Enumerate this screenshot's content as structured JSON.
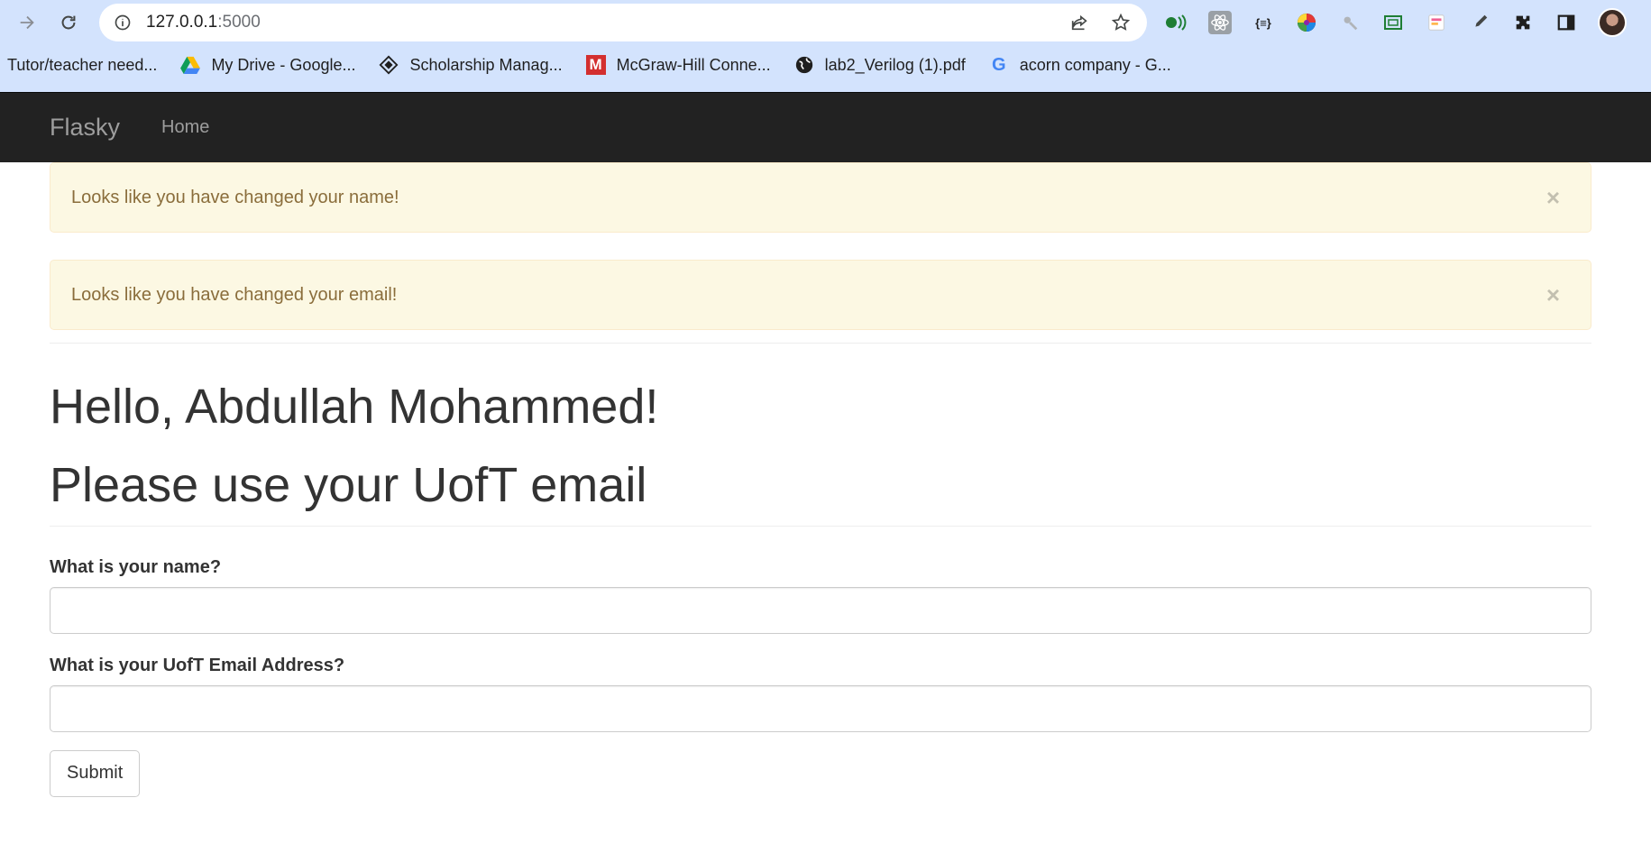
{
  "browser": {
    "url_host": "127.0.0.1",
    "url_port": ":5000",
    "bookmarks": [
      {
        "label": "Tutor/teacher need...",
        "icon": "none"
      },
      {
        "label": "My Drive - Google...",
        "icon": "google-drive-icon"
      },
      {
        "label": "Scholarship Manag...",
        "icon": "diamond-icon"
      },
      {
        "label": "McGraw-Hill Conne...",
        "icon": "mcgraw-hill-icon"
      },
      {
        "label": "lab2_Verilog (1).pdf",
        "icon": "globe-icon"
      },
      {
        "label": "acorn company - G...",
        "icon": "google-icon"
      }
    ]
  },
  "navbar": {
    "brand": "Flasky",
    "home": "Home",
    "bg_color": "#222222"
  },
  "alerts": [
    {
      "message": "Looks like you have changed your name!",
      "close": "×"
    },
    {
      "message": "Looks like you have changed your email!",
      "close": "×"
    }
  ],
  "page_header": {
    "greeting": "Hello, Abdullah Mohammed!",
    "notice": "Please use your UofT email"
  },
  "form": {
    "name_label": "What is your name?",
    "name_value": "",
    "email_label": "What is your UofT Email Address?",
    "email_value": "",
    "submit_label": "Submit"
  }
}
